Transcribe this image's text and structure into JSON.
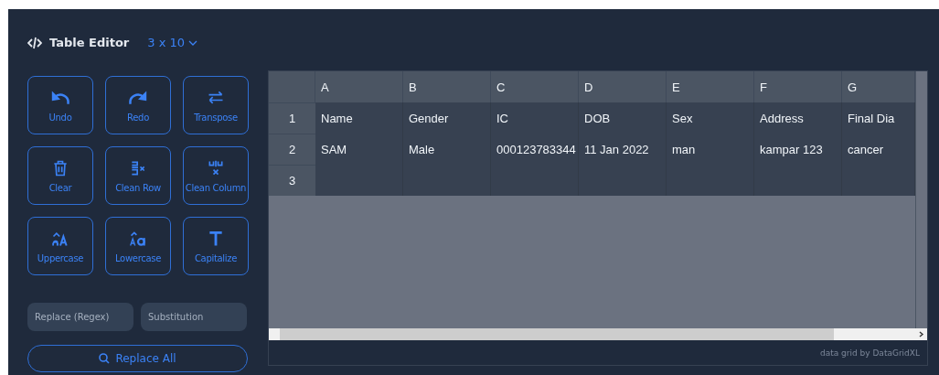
{
  "header": {
    "title": "Table Editor",
    "size": "3 x 10"
  },
  "actions": [
    {
      "label": "Undo",
      "kind": "undo"
    },
    {
      "label": "Redo",
      "kind": "redo"
    },
    {
      "label": "Transpose",
      "kind": "transpose"
    },
    {
      "label": "Clear",
      "kind": "clear"
    },
    {
      "label": "Clean Row",
      "kind": "clean-row"
    },
    {
      "label": "Clean Column",
      "kind": "clean-column"
    },
    {
      "label": "Uppercase",
      "kind": "uppercase"
    },
    {
      "label": "Lowercase",
      "kind": "lowercase"
    },
    {
      "label": "Capitalize",
      "kind": "capitalize"
    }
  ],
  "replace": {
    "pattern_placeholder": "Replace (Regex)",
    "substitution_placeholder": "Substitution",
    "button": "Replace All"
  },
  "grid": {
    "columns": [
      "A",
      "B",
      "C",
      "D",
      "E",
      "F",
      "G"
    ],
    "rows": [
      {
        "number": "1",
        "cells": [
          "Name",
          "Gender",
          "IC",
          "DOB",
          "Sex",
          "Address",
          "Final Dia"
        ]
      },
      {
        "number": "2",
        "cells": [
          "SAM",
          "Male",
          "000123783344",
          "11 Jan 2022",
          "man",
          "kampar 123",
          "cancer"
        ]
      },
      {
        "number": "3",
        "cells": []
      }
    ],
    "credit": "data grid by DataGridXL"
  }
}
